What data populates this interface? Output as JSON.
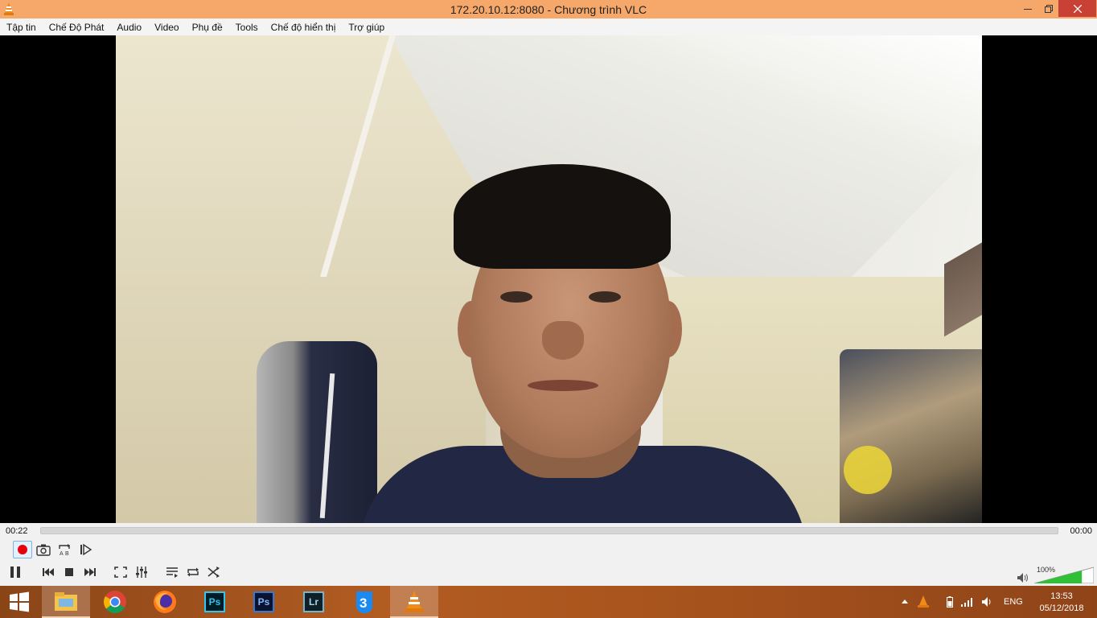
{
  "window": {
    "title": "172.20.10.12:8080 - Chương trình VLC",
    "icon": "vlc-cone-icon"
  },
  "menu": [
    "Tập tin",
    "Chế Độ Phát",
    "Audio",
    "Video",
    "Phụ đề",
    "Tools",
    "Chế độ hiển thị",
    "Trợ giúp"
  ],
  "playback": {
    "elapsed": "00:22",
    "total": "00:00",
    "progress": 0,
    "state": "playing"
  },
  "volume": {
    "label": "100%",
    "level": 1.0
  },
  "controls": {
    "row1": [
      "record-icon",
      "snapshot-icon",
      "loop-ab-icon",
      "frame-step-icon"
    ],
    "row2": [
      "pause-icon",
      "previous-icon",
      "stop-icon",
      "next-icon",
      "fullscreen-icon",
      "extended-settings-icon",
      "playlist-icon",
      "loop-icon",
      "shuffle-icon"
    ]
  },
  "taskbar": {
    "apps": [
      "start-icon",
      "file-explorer-icon",
      "chrome-icon",
      "firefox-icon",
      "photoshop-icon",
      "photoshop-alt-icon",
      "lightroom-icon",
      "zalo-3-icon",
      "vlc-icon"
    ],
    "ps_label": "Ps",
    "lr_label": "Lr",
    "language": "ENG",
    "time": "13:53",
    "date": "05/12/2018"
  },
  "colors": {
    "titlebar": "#f5a86a",
    "close_button": "#c94035",
    "volume_fill": "#2fc035",
    "record": "#e8000b",
    "taskbar": "#a9541d"
  }
}
